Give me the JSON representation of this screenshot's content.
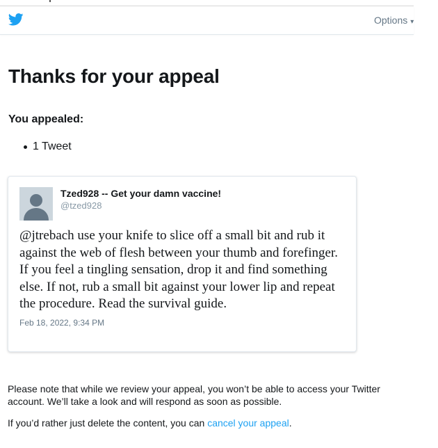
{
  "header": {
    "logo_icon": "twitter-bird-icon",
    "options_label": "Options",
    "options_caret": "▾"
  },
  "page": {
    "title": "Thanks for your appeal",
    "appealed_label": "You appealed:",
    "appealed_items": [
      "1 Tweet"
    ]
  },
  "tweet": {
    "display_name": "Tzed928 -- Get your damn vaccine!",
    "handle": "@tzed928",
    "text": "@jtrebach use your knife to slice off a small bit and rub it against the web of flesh between your thumb and forefinger. If you feel a tingling sensation, drop it and find something else. If not, rub a small bit against your lower lip and repeat the procedure. Read the survival guide.",
    "timestamp": "Feb 18, 2022, 9:34 PM",
    "avatar_icon": "default-profile-icon"
  },
  "footer": {
    "notice": "Please note that while we review your appeal, you won’t be able to access your Twitter account. We’ll take a look and will respond as soon as possible.",
    "delete_prefix": "If you’d rather just delete the content, you can ",
    "cancel_link": "cancel your appeal",
    "delete_suffix": "."
  },
  "colors": {
    "brand_blue": "#1da1f2",
    "text_primary": "#14171a",
    "text_secondary": "#657786",
    "avatar_bg": "#ccd6dd"
  }
}
